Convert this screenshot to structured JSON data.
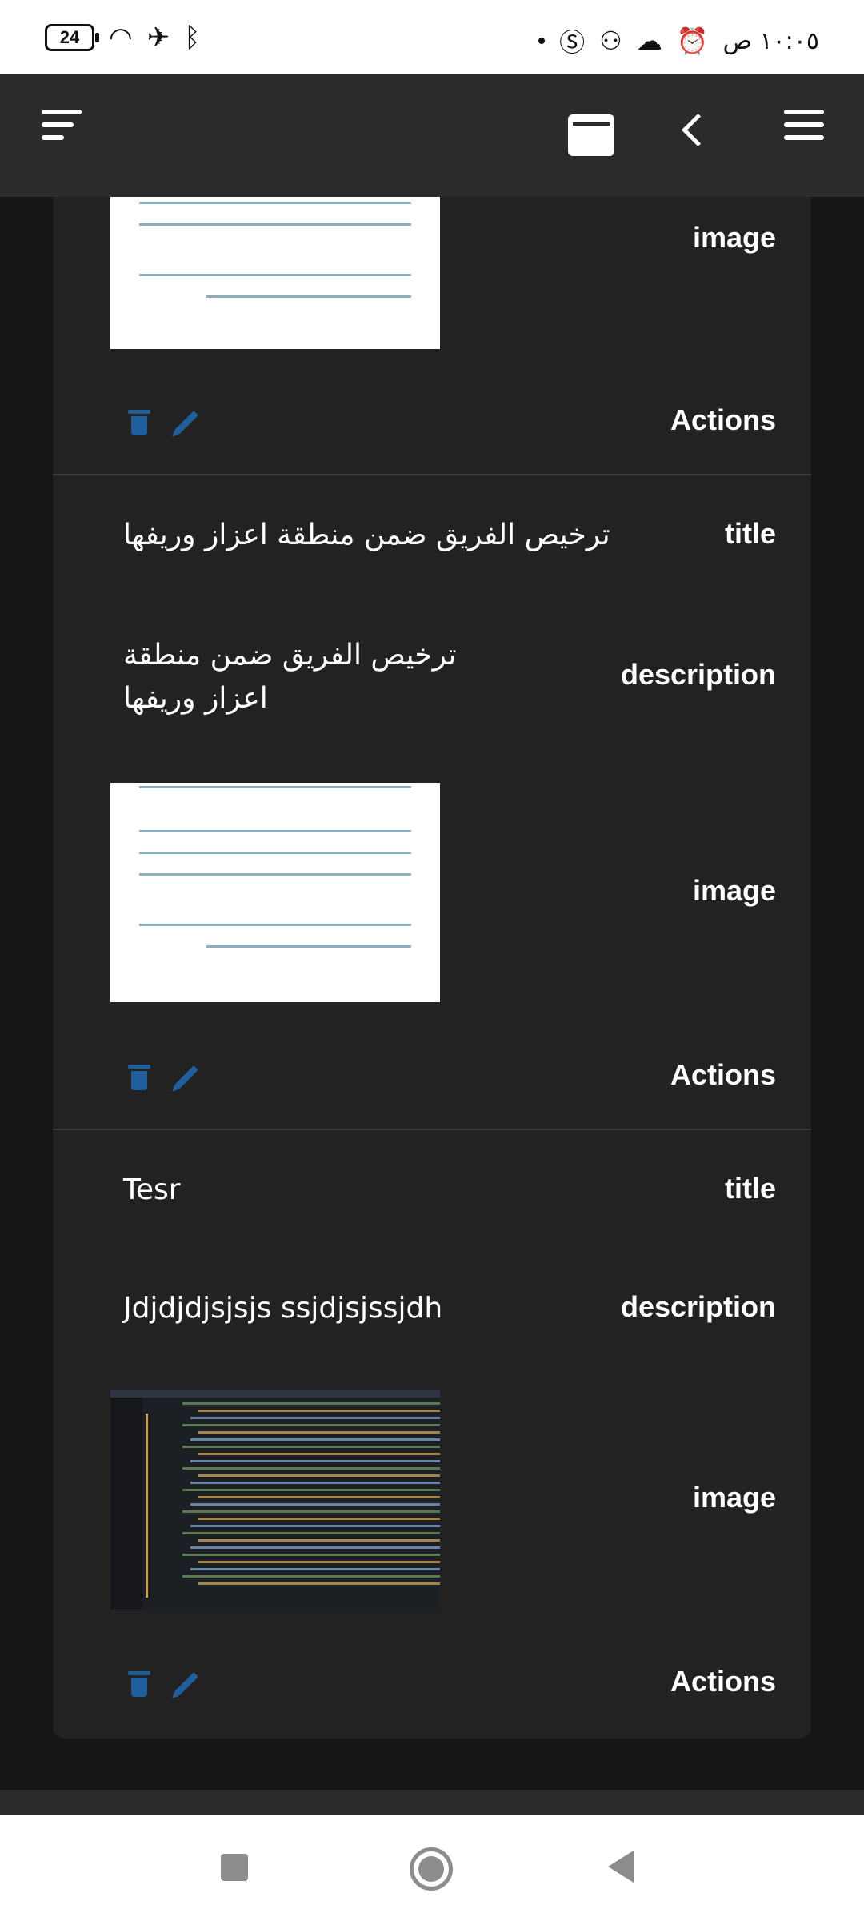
{
  "status_bar": {
    "battery": "24",
    "clock": "١٠:٠٥ ص"
  },
  "records": [
    {
      "title": "",
      "description": "",
      "has_image": true,
      "image_label": "image",
      "actions_label": "Actions"
    },
    {
      "title_label": "title",
      "title": "ترخيص الفريق ضمن منطقة اعزاز وريفها",
      "description_label": "description",
      "description": "ترخيص الفريق ضمن منطقة اعزاز وريفها",
      "image_label": "image",
      "actions_label": "Actions"
    },
    {
      "title_label": "title",
      "title": "Tesr",
      "description_label": "description",
      "description": "Jdjdjdjsjsjs ssjdjsjssjdh",
      "image_label": "image",
      "actions_label": "Actions"
    }
  ]
}
